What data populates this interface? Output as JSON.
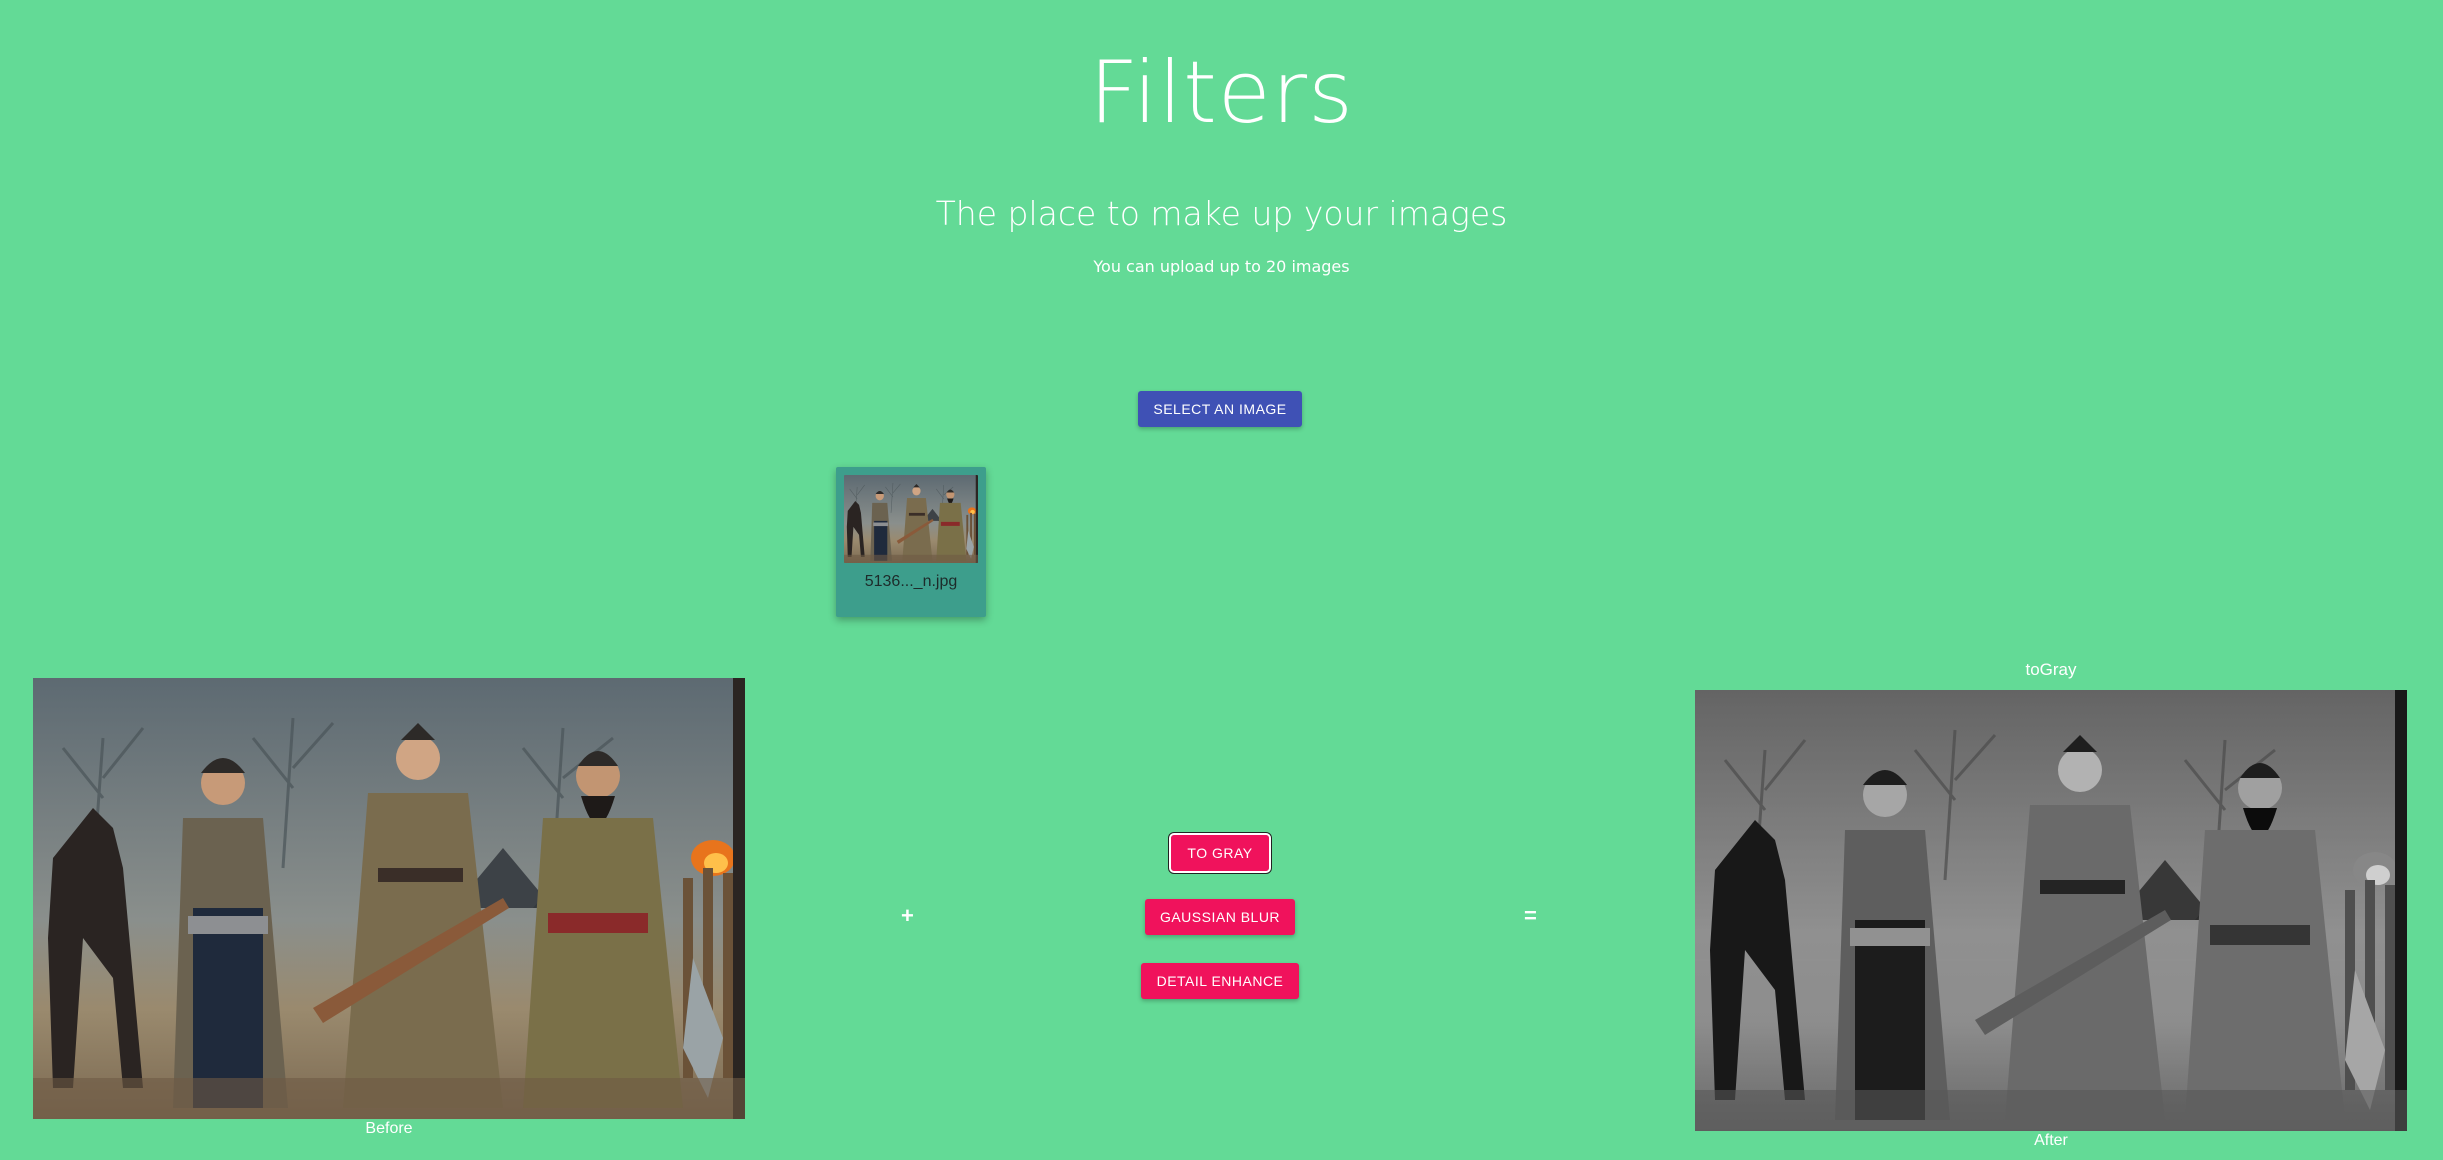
{
  "header": {
    "title": "Filters",
    "subtitle": "The place to make up your images",
    "caption": "You can upload up to 20 images"
  },
  "upload": {
    "select_label": "SELECT AN IMAGE"
  },
  "thumbnails": [
    {
      "filename": "5136..._n.jpg"
    }
  ],
  "workspace": {
    "before_label": "Before",
    "after_label": "After",
    "applied_filter": "toGray",
    "plus_symbol": "+",
    "equals_symbol": "="
  },
  "filters": {
    "to_gray": "TO GRAY",
    "gaussian_blur": "GAUSSIAN BLUR",
    "detail_enhance": "DETAIL ENHANCE"
  },
  "colors": {
    "background": "#63da96",
    "primary_button": "#3f51b5",
    "accent_button": "#f0125c",
    "thumbnail_card": "#3d9e8c"
  }
}
